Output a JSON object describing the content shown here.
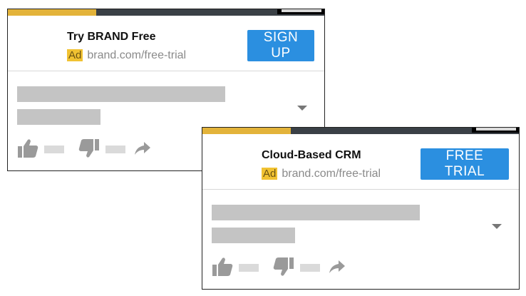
{
  "ads": [
    {
      "title": "Try BRAND Free",
      "badge": "Ad",
      "url": "brand.com/free-trial",
      "cta_label": "SIGN UP",
      "progress_fraction": 0.28
    },
    {
      "title": "Cloud-Based CRM",
      "badge": "Ad",
      "url": "brand.com/free-trial",
      "cta_label": "FREE TRIAL",
      "progress_fraction": 0.28
    }
  ],
  "colors": {
    "progress_played": "#e3b33a",
    "progress_track": "#3a4046",
    "cta_background": "#2b8fe0",
    "ad_badge": "#f1c232",
    "placeholder": "#c4c4c4"
  },
  "icons": {
    "like": "thumbs-up-icon",
    "dislike": "thumbs-down-icon",
    "share": "share-arrow-icon",
    "expand": "chevron-down-icon"
  }
}
